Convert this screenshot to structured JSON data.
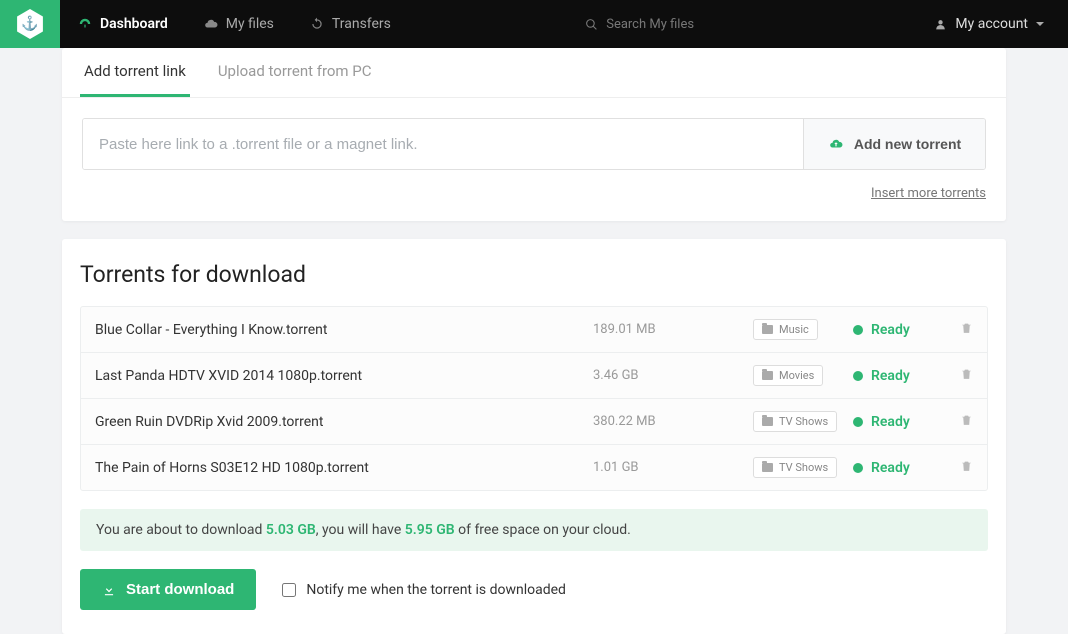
{
  "nav": {
    "dashboard": "Dashboard",
    "myfiles": "My files",
    "transfers": "Transfers",
    "search_placeholder": "Search My files",
    "account": "My account"
  },
  "tabs": {
    "add_link": "Add torrent link",
    "upload_pc": "Upload torrent from PC"
  },
  "add": {
    "placeholder": "Paste here link to a .torrent file or a magnet link.",
    "button": "Add new torrent",
    "insert_more": "Insert more torrents"
  },
  "downloads": {
    "title": "Torrents for download",
    "rows": [
      {
        "name": "Blue Collar - Everything I Know.torrent",
        "size": "189.01 MB",
        "category": "Music",
        "status": "Ready"
      },
      {
        "name": "Last Panda HDTV XVID 2014 1080p.torrent",
        "size": "3.46 GB",
        "category": "Movies",
        "status": "Ready"
      },
      {
        "name": "Green Ruin DVDRip Xvid 2009.torrent",
        "size": "380.22 MB",
        "category": "TV Shows",
        "status": "Ready"
      },
      {
        "name": "The Pain of Horns S03E12 HD 1080p.torrent",
        "size": "1.01 GB",
        "category": "TV Shows",
        "status": "Ready"
      }
    ],
    "info_pre": "You are about to download ",
    "info_total": "5.03 GB",
    "info_mid": ", you will have ",
    "info_free": "5.95 GB",
    "info_post": " of free space on your cloud.",
    "start": "Start download",
    "notify": "Notify me when the torrent is downloaded"
  }
}
